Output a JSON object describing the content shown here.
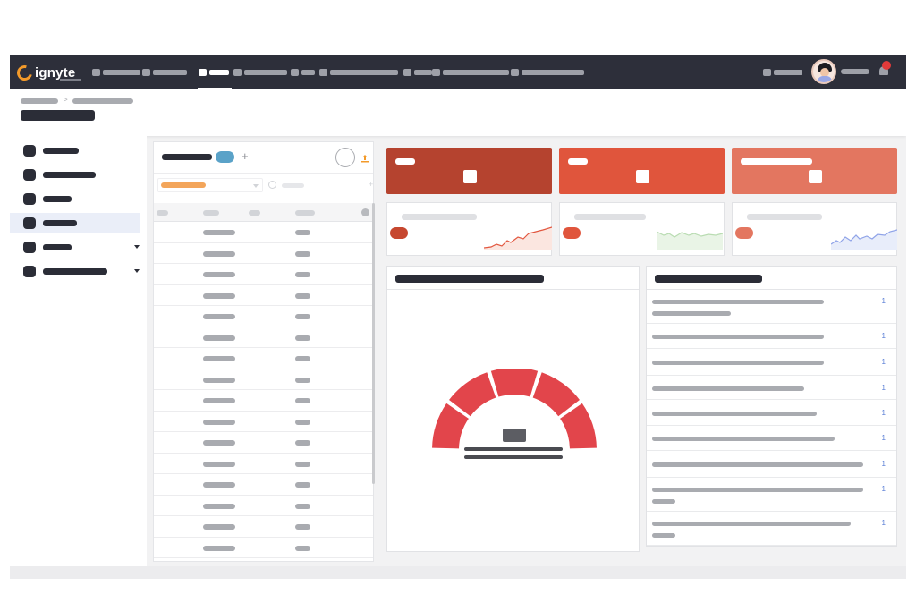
{
  "app": {
    "brand": "ignyte"
  },
  "nav": {
    "items": [
      "nav-item-1",
      "nav-item-2",
      "nav-item-3",
      "nav-item-4",
      "nav-item-5",
      "nav-item-6",
      "nav-item-7",
      "nav-item-8"
    ],
    "active_index": 2
  },
  "sidebar": {
    "items": [
      {
        "name": "sidebar-item-1",
        "expandable": false
      },
      {
        "name": "sidebar-item-2",
        "expandable": false
      },
      {
        "name": "sidebar-item-3",
        "expandable": false
      },
      {
        "name": "sidebar-item-4",
        "expandable": false,
        "active": true
      },
      {
        "name": "sidebar-item-5",
        "expandable": true
      },
      {
        "name": "sidebar-item-6",
        "expandable": true
      }
    ]
  },
  "list": {
    "row_count": 16
  },
  "kpis": [
    {
      "name": "kpi-card-1",
      "color": "#b5432f"
    },
    {
      "name": "kpi-card-2",
      "color": "#e0553c"
    },
    {
      "name": "kpi-card-3",
      "color": "#e37660"
    }
  ],
  "trends": [
    {
      "name": "trend-card-1",
      "pill": "#c6472f",
      "line": "#e2573f",
      "fill": "#fbe6e0"
    },
    {
      "name": "trend-card-2",
      "pill": "#e0553c",
      "line": "#b9dcb2",
      "fill": "#e9f4e6"
    },
    {
      "name": "trend-card-3",
      "pill": "#e37660",
      "line": "#8fa3e8",
      "fill": "#e8edfa"
    }
  ],
  "gauge": {
    "color": "#e2454b",
    "segments": 5
  },
  "tasks": {
    "count": 9,
    "counter_label": "1"
  },
  "colors": {
    "nav_bg": "#2d2f3a",
    "accent": "#f39a2a",
    "tag": "#5aa2c8"
  }
}
